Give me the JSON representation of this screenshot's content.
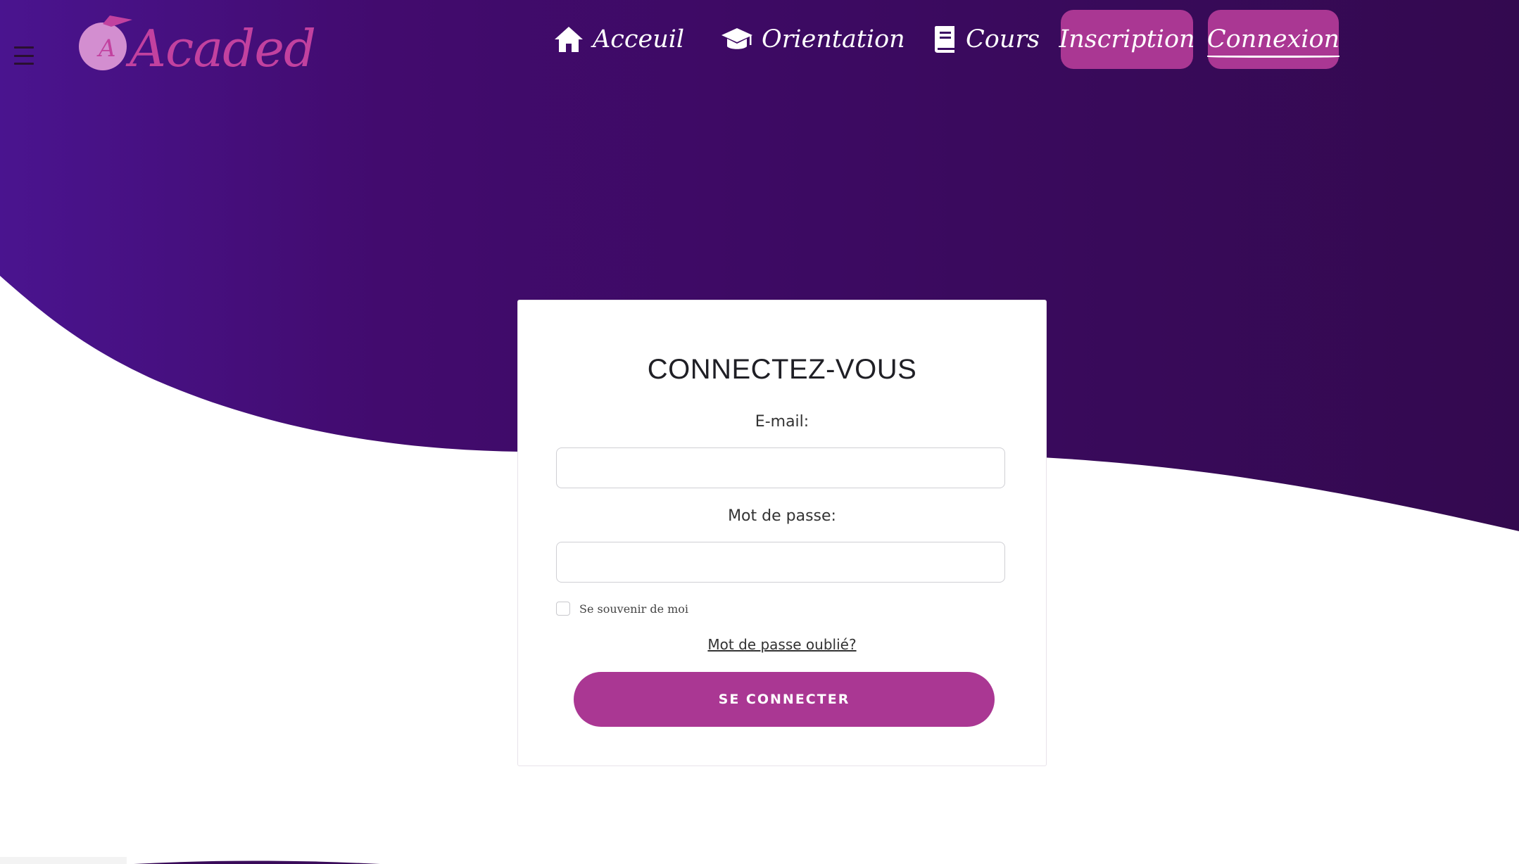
{
  "brand": {
    "logo_text": "Acaded",
    "logo_initial": "A"
  },
  "nav": {
    "items": [
      {
        "label": "Acceuil",
        "icon": "home-icon"
      },
      {
        "label": "Orientation",
        "icon": "graduation-cap-icon"
      },
      {
        "label": "Cours",
        "icon": "book-icon"
      }
    ],
    "register_label": "Inscription",
    "login_label": "Connexion"
  },
  "login": {
    "title": "CONNECTEZ-VOUS",
    "email_label": "E-mail:",
    "email_value": "",
    "password_label": "Mot de passe:",
    "password_value": "",
    "remember_label": "Se souvenir de moi",
    "remember_checked": false,
    "forgot_label": "Mot de passe oublié?",
    "submit_label": "SE CONNECTER"
  },
  "colors": {
    "header_gradient_start": "#4a148f",
    "header_gradient_end": "#33094f",
    "accent": "#aa3793",
    "logo_pink": "#c2419f"
  }
}
